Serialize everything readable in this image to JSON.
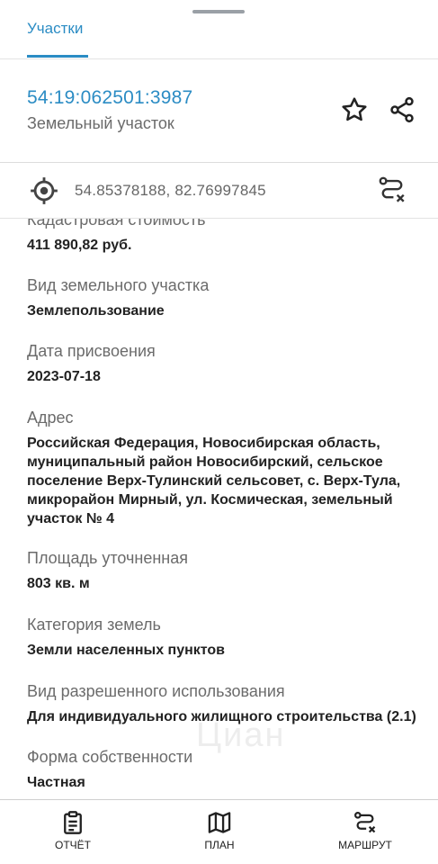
{
  "tabs": [
    {
      "label": "Участки",
      "active": true
    }
  ],
  "header": {
    "cadastral_number": "54:19:062501:3987",
    "object_type": "Земельный участок"
  },
  "coords": {
    "value": "54.85378188, 82.76997845"
  },
  "fields": [
    {
      "label": "Кадастровая стоимость",
      "value": "411 890,82 руб."
    },
    {
      "label": "Вид земельного участка",
      "value": "Землепользование"
    },
    {
      "label": "Дата присвоения",
      "value": "2023-07-18"
    },
    {
      "label": "Адрес",
      "value": "Российская Федерация, Новосибирская область, муниципальный район Новосибирский, сельское поселение Верх-Тулинский сельсовет, с. Верх-Тула, микрорайон Мирный, ул. Космическая, земельный участок № 4"
    },
    {
      "label": "Площадь уточненная",
      "value": "803 кв. м"
    },
    {
      "label": "Категория земель",
      "value": "Земли населенных пунктов"
    },
    {
      "label": "Вид разрешенного использования",
      "value": "Для индивидуального жилищного строительства (2.1)"
    },
    {
      "label": "Форма собственности",
      "value": "Частная"
    }
  ],
  "watermark": "Циан",
  "bottom_nav": [
    {
      "label": "ОТЧЁТ",
      "icon": "clipboard-icon"
    },
    {
      "label": "ПЛАН",
      "icon": "map-icon"
    },
    {
      "label": "МАРШРУТ",
      "icon": "route-icon"
    }
  ],
  "colors": {
    "accent": "#2b8cc4"
  }
}
